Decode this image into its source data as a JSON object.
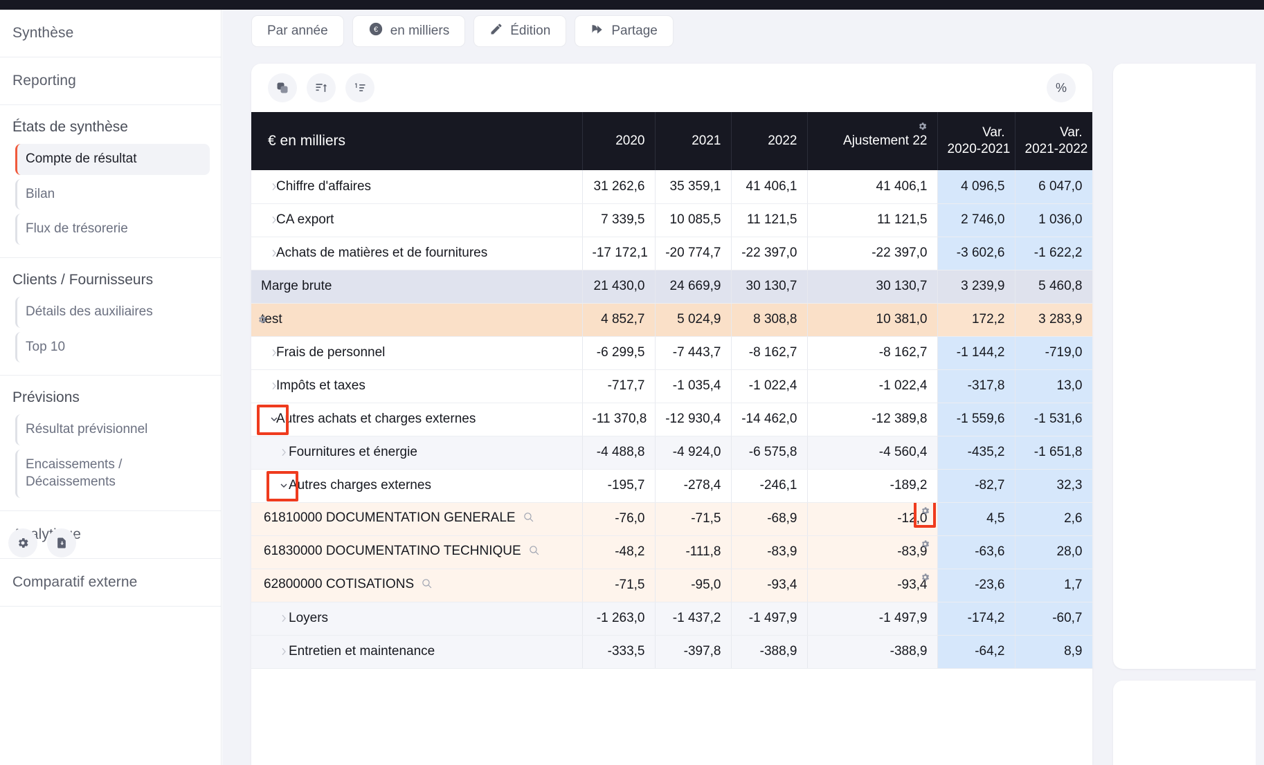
{
  "sidebar": {
    "groups": [
      {
        "title": "Synthèse",
        "type": "top",
        "items": []
      },
      {
        "title": "Reporting",
        "type": "top",
        "items": []
      },
      {
        "title": "États de synthèse",
        "type": "head",
        "items": [
          {
            "label": "Compte de résultat",
            "active": true
          },
          {
            "label": "Bilan",
            "active": false
          },
          {
            "label": "Flux de trésorerie",
            "active": false
          }
        ]
      },
      {
        "title": "Clients / Fournisseurs",
        "type": "head",
        "items": [
          {
            "label": "Détails des auxiliaires",
            "active": false
          },
          {
            "label": "Top 10",
            "active": false
          }
        ]
      },
      {
        "title": "Prévisions",
        "type": "head",
        "items": [
          {
            "label": "Résultat prévisionnel",
            "active": false
          },
          {
            "label": "Encaissements /\nDécaissements",
            "active": false
          }
        ]
      },
      {
        "title": "Analytique",
        "type": "top",
        "items": []
      },
      {
        "title": "Comparatif externe",
        "type": "top",
        "items": []
      }
    ],
    "footer_icons": [
      {
        "name": "gear-icon",
        "label": "Paramètres"
      },
      {
        "name": "file-download-icon",
        "label": "Exporter"
      }
    ]
  },
  "toolbar": {
    "buttons": [
      {
        "label": "Par année",
        "icon": "none"
      },
      {
        "label": "en milliers",
        "icon": "euro-coin-icon"
      },
      {
        "label": "Édition",
        "icon": "pencil-icon"
      },
      {
        "label": "Partage",
        "icon": "share-arrow-icon"
      }
    ]
  },
  "card_tools": {
    "left": [
      {
        "name": "duplicate-icon",
        "label": "Dupliquer"
      },
      {
        "name": "sort-asc-icon",
        "label": "Trier croissant"
      },
      {
        "name": "sort-numeric-icon",
        "label": "Trier numérique"
      }
    ],
    "right": {
      "name": "percent-icon",
      "label": "%"
    }
  },
  "table": {
    "columns": [
      {
        "key": "label",
        "label": "€ en milliers",
        "align": "left"
      },
      {
        "key": "y2020",
        "label": "2020",
        "align": "right"
      },
      {
        "key": "y2021",
        "label": "2021",
        "align": "right"
      },
      {
        "key": "y2022",
        "label": "2022",
        "align": "right"
      },
      {
        "key": "adj22",
        "label": "Ajustement 22",
        "align": "right",
        "gear": true
      },
      {
        "key": "var2021",
        "label_line1": "Var.",
        "label_line2": "2020-2021",
        "align": "right",
        "variation": true
      },
      {
        "key": "var2022",
        "label_line1": "Var.",
        "label_line2": "2021-2022",
        "align": "right",
        "variation": true
      }
    ],
    "rows": [
      {
        "label": "Chiffre d'affaires",
        "chevron": "right",
        "indent": 0,
        "style": "plain",
        "y2020": "31 262,6",
        "y2021": "35 359,1",
        "y2022": "41 406,1",
        "adj22": "41 406,1",
        "var2021": "4 096,5",
        "var2022": "6 047,0"
      },
      {
        "label": "CA export",
        "chevron": "right",
        "indent": 0,
        "style": "plain",
        "y2020": "7 339,5",
        "y2021": "10 085,5",
        "y2022": "11 121,5",
        "adj22": "11 121,5",
        "var2021": "2 746,0",
        "var2022": "1 036,0"
      },
      {
        "label": "Achats de matières et de fournitures",
        "chevron": "right",
        "indent": 0,
        "style": "plain",
        "y2020": "-17 172,1",
        "y2021": "-20 774,7",
        "y2022": "-22 397,0",
        "adj22": "-22 397,0",
        "var2021": "-3 602,6",
        "var2022": "-1 622,2"
      },
      {
        "label": "Marge brute",
        "chevron": "none",
        "indent": 0,
        "style": "total",
        "y2020": "21 430,0",
        "y2021": "24 669,9",
        "y2022": "30 130,7",
        "adj22": "30 130,7",
        "var2021": "3 239,9",
        "var2022": "5 460,8"
      },
      {
        "label": "test",
        "chevron": "none",
        "indent": 0,
        "style": "test",
        "row_gear": true,
        "y2020": "4 852,7",
        "y2021": "5 024,9",
        "y2022": "8 308,8",
        "adj22": "10 381,0",
        "var2021": "172,2",
        "var2022": "3 283,9"
      },
      {
        "label": "Frais de personnel",
        "chevron": "right",
        "indent": 0,
        "style": "plain",
        "y2020": "-6 299,5",
        "y2021": "-7 443,7",
        "y2022": "-8 162,7",
        "adj22": "-8 162,7",
        "var2021": "-1 144,2",
        "var2022": "-719,0"
      },
      {
        "label": "Impôts et taxes",
        "chevron": "right",
        "indent": 0,
        "style": "plain",
        "y2020": "-717,7",
        "y2021": "-1 035,4",
        "y2022": "-1 022,4",
        "adj22": "-1 022,4",
        "var2021": "-317,8",
        "var2022": "13,0"
      },
      {
        "label": "Autres achats et charges externes",
        "chevron": "down",
        "indent": 0,
        "style": "plain",
        "highlight_chevron": true,
        "y2020": "-11 370,8",
        "y2021": "-12 930,4",
        "y2022": "-14 462,0",
        "adj22": "-12 389,8",
        "var2021": "-1 559,6",
        "var2022": "-1 531,6"
      },
      {
        "label": "Fournitures et énergie",
        "chevron": "right",
        "indent": 1,
        "style": "sub",
        "y2020": "-4 488,8",
        "y2021": "-4 924,0",
        "y2022": "-6 575,8",
        "adj22": "-4 560,4",
        "var2021": "-435,2",
        "var2022": "-1 651,8"
      },
      {
        "label": "Autres charges externes",
        "chevron": "down",
        "indent": 1,
        "style": "plain",
        "highlight_chevron": true,
        "y2020": "-195,7",
        "y2021": "-278,4",
        "y2022": "-246,1",
        "adj22": "-189,2",
        "var2021": "-82,7",
        "var2022": "32,3"
      },
      {
        "label": "61810000 DOCUMENTATION GENERALE",
        "chevron": "none",
        "indent": 0,
        "style": "acct",
        "magnifier": true,
        "adj_gear": true,
        "highlight_adj_gear": true,
        "y2020": "-76,0",
        "y2021": "-71,5",
        "y2022": "-68,9",
        "adj22": "-12,0",
        "var2021": "4,5",
        "var2022": "2,6"
      },
      {
        "label": "61830000 DOCUMENTATINO TECHNIQUE",
        "chevron": "none",
        "indent": 0,
        "style": "acct",
        "magnifier": true,
        "adj_gear": true,
        "y2020": "-48,2",
        "y2021": "-111,8",
        "y2022": "-83,9",
        "adj22": "-83,9",
        "var2021": "-63,6",
        "var2022": "28,0"
      },
      {
        "label": "62800000 COTISATIONS",
        "chevron": "none",
        "indent": 0,
        "style": "acct",
        "magnifier": true,
        "adj_gear": true,
        "y2020": "-71,5",
        "y2021": "-95,0",
        "y2022": "-93,4",
        "adj22": "-93,4",
        "var2021": "-23,6",
        "var2022": "1,7"
      },
      {
        "label": "Loyers",
        "chevron": "right",
        "indent": 1,
        "style": "sub",
        "y2020": "-1 263,0",
        "y2021": "-1 437,2",
        "y2022": "-1 497,9",
        "adj22": "-1 497,9",
        "var2021": "-174,2",
        "var2022": "-60,7"
      },
      {
        "label": "Entretien et maintenance",
        "chevron": "right",
        "indent": 1,
        "style": "sub",
        "y2020": "-333,5",
        "y2021": "-397,8",
        "y2022": "-388,9",
        "adj22": "-388,9",
        "var2021": "-64,2",
        "var2022": "8,9"
      }
    ]
  },
  "colors": {
    "accent": "#f05a3c",
    "header_bg": "#171822",
    "variation_col": "#d6e7fb",
    "total_row": "#e0e3ee",
    "test_row": "#fae0c8",
    "account_row": "#fef4ec",
    "highlight_box": "#ef3b1e"
  }
}
